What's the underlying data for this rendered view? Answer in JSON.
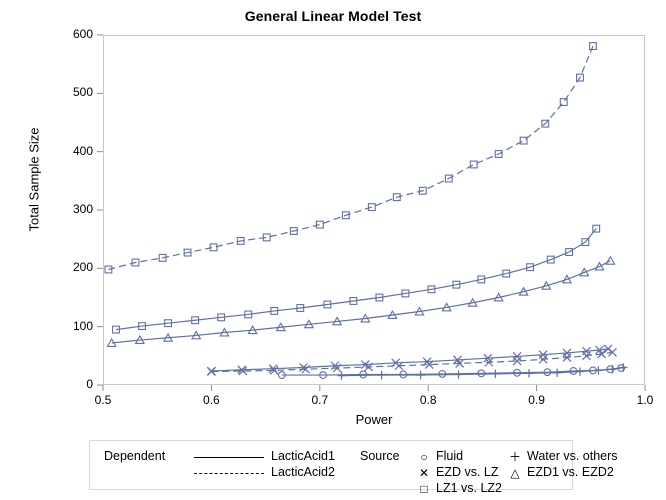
{
  "chart_data": {
    "type": "line",
    "title": "General Linear Model Test",
    "xlabel": "Power",
    "ylabel": "Total Sample Size",
    "xlim": [
      0.5,
      1.0
    ],
    "ylim": [
      0,
      600
    ],
    "xticks": [
      "0.5",
      "0.6",
      "0.7",
      "0.8",
      "0.9",
      "1.0"
    ],
    "xtick_values": [
      0.5,
      0.6,
      0.7,
      0.8,
      0.9,
      1.0
    ],
    "yticks": [
      "0",
      "100",
      "200",
      "300",
      "400",
      "500",
      "600"
    ],
    "ytick_values": [
      0,
      100,
      200,
      300,
      400,
      500,
      600
    ],
    "grid": false,
    "legend_position": "bottom",
    "line_color": "#5f6fa8",
    "series": [
      {
        "name": "LZ1 vs. LZ2 / LacticAcid2",
        "dependent": "LacticAcid2",
        "source": "LZ1 vs. LZ2",
        "marker": "square",
        "line_style": "dashed",
        "x": [
          0.505,
          0.53,
          0.555,
          0.578,
          0.602,
          0.627,
          0.651,
          0.676,
          0.7,
          0.724,
          0.748,
          0.771,
          0.795,
          0.819,
          0.842,
          0.865,
          0.888,
          0.908,
          0.925,
          0.94,
          0.952
        ],
        "y": [
          198,
          210,
          218,
          227,
          236,
          247,
          253,
          264,
          275,
          291,
          305,
          322,
          333,
          354,
          378,
          396,
          419,
          448,
          485,
          527,
          581
        ]
      },
      {
        "name": "LZ1 vs. LZ2 / LacticAcid1",
        "dependent": "LacticAcid1",
        "source": "LZ1 vs. LZ2",
        "marker": "square",
        "line_style": "solid",
        "x": [
          0.512,
          0.536,
          0.56,
          0.585,
          0.609,
          0.634,
          0.658,
          0.682,
          0.707,
          0.731,
          0.755,
          0.779,
          0.803,
          0.826,
          0.849,
          0.872,
          0.894,
          0.913,
          0.93,
          0.945,
          0.955
        ],
        "y": [
          95,
          101,
          106,
          111,
          116,
          121,
          127,
          132,
          138,
          144,
          150,
          157,
          164,
          172,
          181,
          191,
          202,
          215,
          228,
          245,
          268
        ]
      },
      {
        "name": "EZD1 vs. EZD2 / LacticAcid1",
        "dependent": "LacticAcid1",
        "source": "EZD1 vs. EZD2",
        "marker": "triangle",
        "line_style": "solid",
        "x": [
          0.508,
          0.534,
          0.56,
          0.586,
          0.612,
          0.638,
          0.664,
          0.69,
          0.716,
          0.742,
          0.767,
          0.792,
          0.817,
          0.841,
          0.865,
          0.888,
          0.909,
          0.928,
          0.944,
          0.958,
          0.968
        ],
        "y": [
          72,
          77,
          81,
          85,
          90,
          94,
          99,
          104,
          109,
          114,
          120,
          126,
          133,
          141,
          150,
          160,
          170,
          181,
          193,
          203,
          213
        ]
      },
      {
        "name": "EZD vs. LZ / LacticAcid1",
        "dependent": "LacticAcid1",
        "source": "EZD vs. LZ",
        "marker": "x",
        "line_style": "solid",
        "x": [
          0.6,
          0.628,
          0.657,
          0.685,
          0.714,
          0.742,
          0.77,
          0.799,
          0.827,
          0.855,
          0.882,
          0.906,
          0.928,
          0.946,
          0.958,
          0.966
        ],
        "y": [
          24,
          26,
          28,
          30,
          33,
          35,
          38,
          40,
          43,
          46,
          49,
          52,
          55,
          58,
          60,
          62
        ]
      },
      {
        "name": "EZD vs. LZ / LacticAcid2",
        "dependent": "LacticAcid2",
        "source": "EZD vs. LZ",
        "marker": "x",
        "line_style": "dashed",
        "x": [
          0.6,
          0.629,
          0.658,
          0.687,
          0.716,
          0.745,
          0.773,
          0.801,
          0.829,
          0.856,
          0.882,
          0.906,
          0.928,
          0.946,
          0.96,
          0.97
        ],
        "y": [
          23,
          24,
          25,
          27,
          29,
          31,
          33,
          35,
          37,
          39,
          41,
          44,
          47,
          50,
          53,
          56
        ]
      },
      {
        "name": "Fluid / LacticAcid1",
        "dependent": "LacticAcid1",
        "source": "Fluid",
        "marker": "circle",
        "line_style": "solid",
        "x": [
          0.665,
          0.703,
          0.74,
          0.777,
          0.813,
          0.849,
          0.882,
          0.91,
          0.934,
          0.952,
          0.968,
          0.978
        ],
        "y": [
          17,
          17,
          18,
          18,
          19,
          20,
          21,
          22,
          24,
          25,
          27,
          29
        ]
      },
      {
        "name": "Water vs. others / LacticAcid1",
        "dependent": "LacticAcid1",
        "source": "Water vs. others",
        "marker": "plus",
        "line_style": "solid",
        "x": [
          0.72,
          0.757,
          0.793,
          0.828,
          0.862,
          0.893,
          0.919,
          0.94,
          0.957,
          0.97,
          0.98
        ],
        "y": [
          16,
          17,
          17,
          18,
          19,
          20,
          21,
          23,
          25,
          27,
          30
        ]
      }
    ]
  },
  "legend": {
    "group1_title": "Dependent",
    "group1_entries": [
      {
        "label": "LacticAcid1",
        "style": "solid"
      },
      {
        "label": "LacticAcid2",
        "style": "dashed"
      }
    ],
    "group2_title": "Source",
    "group2_entries": [
      {
        "label": "Fluid",
        "symbol": "circle",
        "glyph": "○"
      },
      {
        "label": "EZD vs. LZ",
        "symbol": "x",
        "glyph": "✕"
      },
      {
        "label": "LZ1 vs. LZ2",
        "symbol": "square",
        "glyph": "□"
      },
      {
        "label": "Water vs. others",
        "symbol": "plus",
        "glyph": "＋"
      },
      {
        "label": "EZD1 vs. EZD2",
        "symbol": "triangle",
        "glyph": "△"
      }
    ]
  }
}
